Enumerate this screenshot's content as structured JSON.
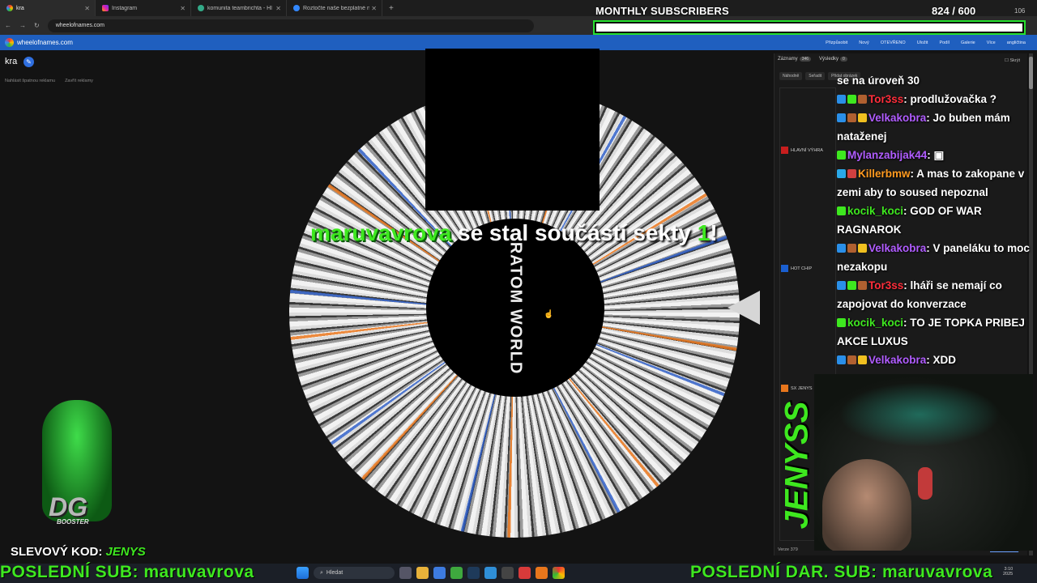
{
  "browser": {
    "tabs": [
      {
        "label": "kra",
        "active": true
      },
      {
        "label": "Instagram",
        "active": false
      },
      {
        "label": "komunita teambrichta - Hledat",
        "active": false
      },
      {
        "label": "Roztočte naše bezplatné náhod",
        "active": false
      }
    ],
    "url": "wheelofnames.com"
  },
  "site": {
    "name": "wheelofnames.com",
    "menu": [
      "Přizpůsobit",
      "Nový",
      "OTEVŘENO",
      "Uložit",
      "Podíl",
      "Galerie",
      "Více",
      "angličtina"
    ]
  },
  "overlay": {
    "subs_title": "MONTHLY SUBSCRIBERS",
    "subs_count": "824 / 600",
    "subs_extra": "106",
    "subs_progress": 1.0
  },
  "wheel": {
    "title": "kra",
    "ad_links": [
      "Nahlásit špatnou reklamu",
      "Zavřít reklamy"
    ],
    "hub_logo": "RATOM WORLD",
    "winner_name": "maruvavrova",
    "winner_text_pre": "se stal součástí sekty ",
    "winner_text_num": "1",
    "winner_text_post": "!"
  },
  "panel": {
    "tab_entries": "Záznamy",
    "tab_entries_count": "346",
    "tab_results": "Výsledky",
    "tab_results_count": "0",
    "hide": "Skrýt",
    "tools": [
      "Náhodně",
      "Seřadit",
      "Přidat obrázek"
    ],
    "entries": [
      {
        "label": "HLAVNÍ VÝHRA",
        "color": "#c81e1e"
      },
      {
        "label": "HOT CHIP",
        "color": "#1a5fd0"
      },
      {
        "label": "SX JENYS",
        "color": "#e8761c"
      }
    ],
    "version": "Verze 379",
    "changes": "Seznam změn"
  },
  "chat": [
    {
      "user": "",
      "color": "#fff",
      "text": "se na úroveň 30",
      "badges": []
    },
    {
      "user": "Tor3ss",
      "color": "#ff2d3a",
      "text": ": prodlužovačka ?",
      "badges": [
        "#2a8fe8",
        "#3ee81f",
        "#b06030"
      ]
    },
    {
      "user": "Velkakobra",
      "color": "#b05cff",
      "text": ": Jo buben mám nataženej",
      "badges": [
        "#2a8fe8",
        "#b06030",
        "#f0c020"
      ]
    },
    {
      "user": "Mylanzabijak44",
      "color": "#b05cff",
      "text": ": ▣",
      "badges": [
        "#3ee81f"
      ]
    },
    {
      "user": "Killerbmw",
      "color": "#ff9a1f",
      "text": ": A mas to zakopane v zemi aby to soused nepoznal",
      "badges": [
        "#2aa8e8",
        "#d04040"
      ]
    },
    {
      "user": "kocik_koci",
      "color": "#3ee81f",
      "text": ": GOD OF WAR RAGNAROK",
      "badges": [
        "#3ee81f"
      ]
    },
    {
      "user": "Velkakobra",
      "color": "#b05cff",
      "text": ": V paneláku to moc nezakopu",
      "badges": [
        "#2a8fe8",
        "#b06030",
        "#f0c020"
      ]
    },
    {
      "user": "Tor3ss",
      "color": "#ff2d3a",
      "text": ": lháři se nemají co zapojovat do konverzace",
      "badges": [
        "#2a8fe8",
        "#3ee81f",
        "#b06030"
      ]
    },
    {
      "user": "kocik_koci",
      "color": "#3ee81f",
      "text": ": TO JE TOPKA PRIBEJ AKCE LUXUS",
      "badges": [
        "#3ee81f"
      ]
    },
    {
      "user": "Velkakobra",
      "color": "#b05cff",
      "text": ": XDD",
      "badges": [
        "#2a8fe8",
        "#b06030",
        "#f0c020"
      ]
    }
  ],
  "stream": {
    "jenyss": "JENYSS",
    "mascot_logo": "DG",
    "mascot_sub": "BOOSTER",
    "promo_label": "SLEVOVÝ KOD: ",
    "promo_code": "JENYS",
    "ticker_left": "POSLEDNÍ SUB: maruvavrova",
    "ticker_right": "POSLEDNÍ DAR. SUB: maruvavrova"
  },
  "taskbar": {
    "search": "Hledat",
    "time": "3:10",
    "date": "2025"
  }
}
